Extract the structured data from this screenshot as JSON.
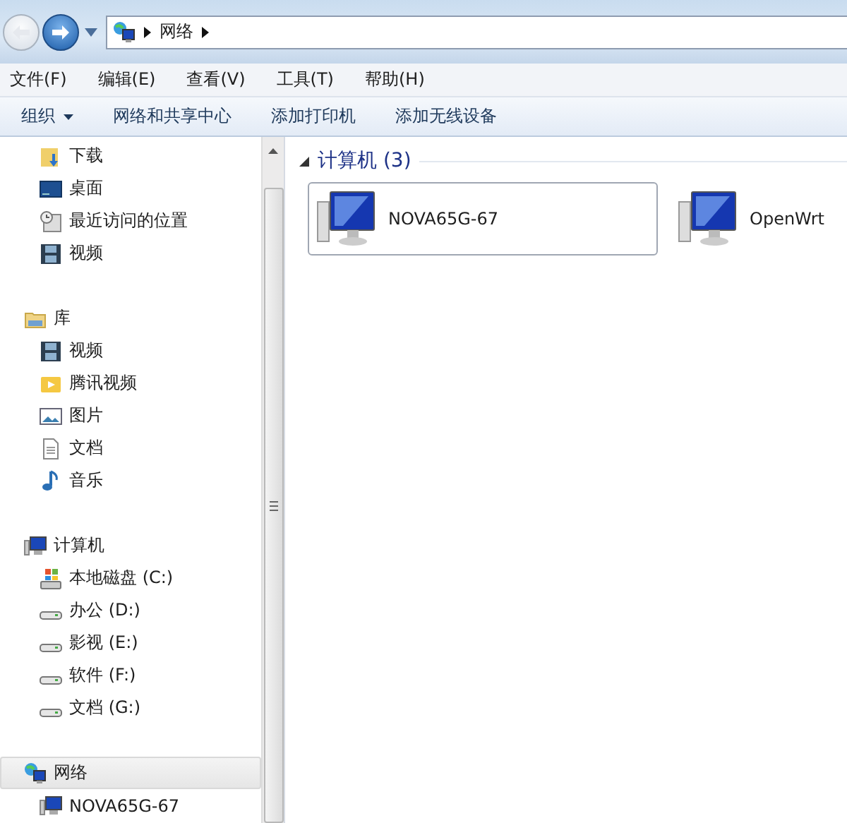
{
  "address_bar": {
    "back_disabled": true,
    "forward_disabled": false,
    "path": [
      "网络"
    ]
  },
  "menu": [
    "文件(F)",
    "编辑(E)",
    "查看(V)",
    "工具(T)",
    "帮助(H)"
  ],
  "toolbar": [
    {
      "label": "组织",
      "dropdown": true
    },
    {
      "label": "网络和共享中心",
      "dropdown": false
    },
    {
      "label": "添加打印机",
      "dropdown": false
    },
    {
      "label": "添加无线设备",
      "dropdown": false
    }
  ],
  "sidebar": {
    "sections": [
      {
        "items": [
          {
            "label": "下载",
            "kind": "download",
            "selected": false
          },
          {
            "label": "桌面",
            "kind": "desktop",
            "selected": false
          },
          {
            "label": "最近访问的位置",
            "kind": "recent",
            "selected": false
          },
          {
            "label": "视频",
            "kind": "video",
            "selected": false
          }
        ]
      },
      {
        "header": {
          "label": "库",
          "kind": "library",
          "selected": false
        },
        "items": [
          {
            "label": "视频",
            "kind": "video",
            "selected": false
          },
          {
            "label": "腾讯视频",
            "kind": "folder",
            "selected": false
          },
          {
            "label": "图片",
            "kind": "picture",
            "selected": false
          },
          {
            "label": "文档",
            "kind": "document",
            "selected": false
          },
          {
            "label": "音乐",
            "kind": "music",
            "selected": false
          }
        ]
      },
      {
        "header": {
          "label": "计算机",
          "kind": "computer",
          "selected": false
        },
        "items": [
          {
            "label": "本地磁盘 (C:)",
            "kind": "system-drive",
            "selected": false
          },
          {
            "label": "办公 (D:)",
            "kind": "drive",
            "selected": false
          },
          {
            "label": "影视 (E:)",
            "kind": "drive",
            "selected": false
          },
          {
            "label": "软件 (F:)",
            "kind": "drive",
            "selected": false
          },
          {
            "label": "文档 (G:)",
            "kind": "drive",
            "selected": false
          }
        ]
      },
      {
        "header": {
          "label": "网络",
          "kind": "network",
          "selected": true
        },
        "items": [
          {
            "label": "NOVA65G-67",
            "kind": "computer",
            "selected": false
          }
        ]
      }
    ]
  },
  "content": {
    "group": {
      "title": "计算机 (3)",
      "expanded": true
    },
    "items": [
      {
        "name": "NOVA65G-67",
        "selected": true
      },
      {
        "name": "OpenWrt",
        "selected": false
      }
    ]
  }
}
